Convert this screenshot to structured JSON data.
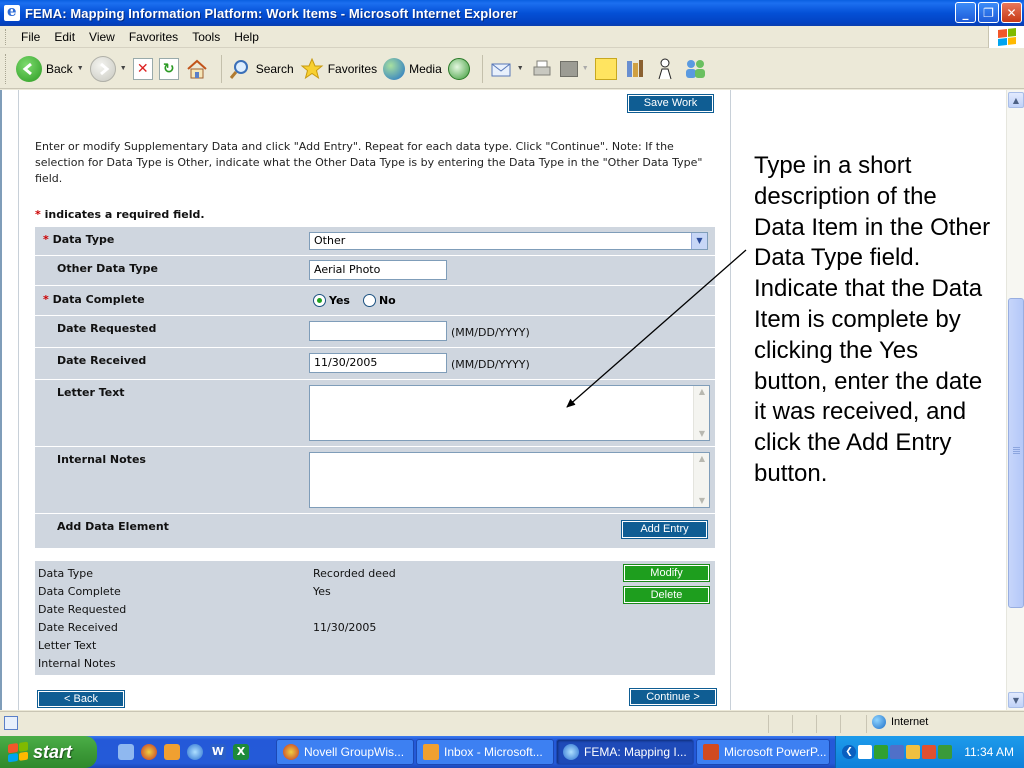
{
  "window": {
    "title": "FEMA: Mapping Information Platform: Work Items - Microsoft Internet Explorer",
    "minimize": "_",
    "maximize": "❐",
    "close": "✕"
  },
  "menu": [
    "File",
    "Edit",
    "View",
    "Favorites",
    "Tools",
    "Help"
  ],
  "toolbar": {
    "back": "Back",
    "search": "Search",
    "favorites": "Favorites",
    "media": "Media"
  },
  "page": {
    "save_work": "Save Work",
    "instructions": "Enter or modify Supplementary Data and click \"Add Entry\". Repeat for each data type. Click \"Continue\". Note: If the selection for Data Type is Other, indicate what the Other Data Type is by entering the Data Type in the \"Other Data Type\" field.",
    "required_star": "*",
    "required_note": "indicates a required field.",
    "form": {
      "data_type_label": "Data Type",
      "data_type_value": "Other",
      "other_type_label": "Other Data Type",
      "other_type_value": "Aerial Photo",
      "complete_label": "Data Complete",
      "yes": "Yes",
      "no": "No",
      "complete_selected": "Yes",
      "date_requested_label": "Date Requested",
      "date_requested_value": "",
      "date_received_label": "Date Received",
      "date_received_value": "11/30/2005",
      "date_format": "(MM/DD/YYYY)",
      "letter_text_label": "Letter Text",
      "internal_notes_label": "Internal Notes",
      "add_element_label": "Add Data Element",
      "add_entry": "Add Entry"
    },
    "summary": {
      "labels": [
        "Data Type",
        "Data Complete",
        "Date Requested",
        "Date Received",
        "Letter Text",
        "Internal Notes"
      ],
      "values": [
        "Recorded deed",
        "Yes",
        "",
        "11/30/2005",
        "",
        ""
      ],
      "modify": "Modify",
      "delete": "Delete"
    },
    "back": "< Back",
    "continue": "Continue >"
  },
  "callout": "Type in a short description of the Data Item in the Other Data Type field. Indicate that the Data Item is complete by clicking the Yes button, enter the date it was received, and click the Add Entry button.",
  "status": {
    "zone": "Internet"
  },
  "taskbar": {
    "start": "start",
    "tasks": [
      "Novell GroupWis...",
      "Inbox - Microsoft...",
      "FEMA: Mapping I...",
      "Microsoft PowerP..."
    ],
    "active_task": "FEMA: Mapping I...",
    "clock": "11:34 AM"
  },
  "colors": {
    "panel": "#CFD6DF",
    "blue_button": "#0F5D93",
    "green_button": "#1E9E1E",
    "required": "#CC0000"
  }
}
